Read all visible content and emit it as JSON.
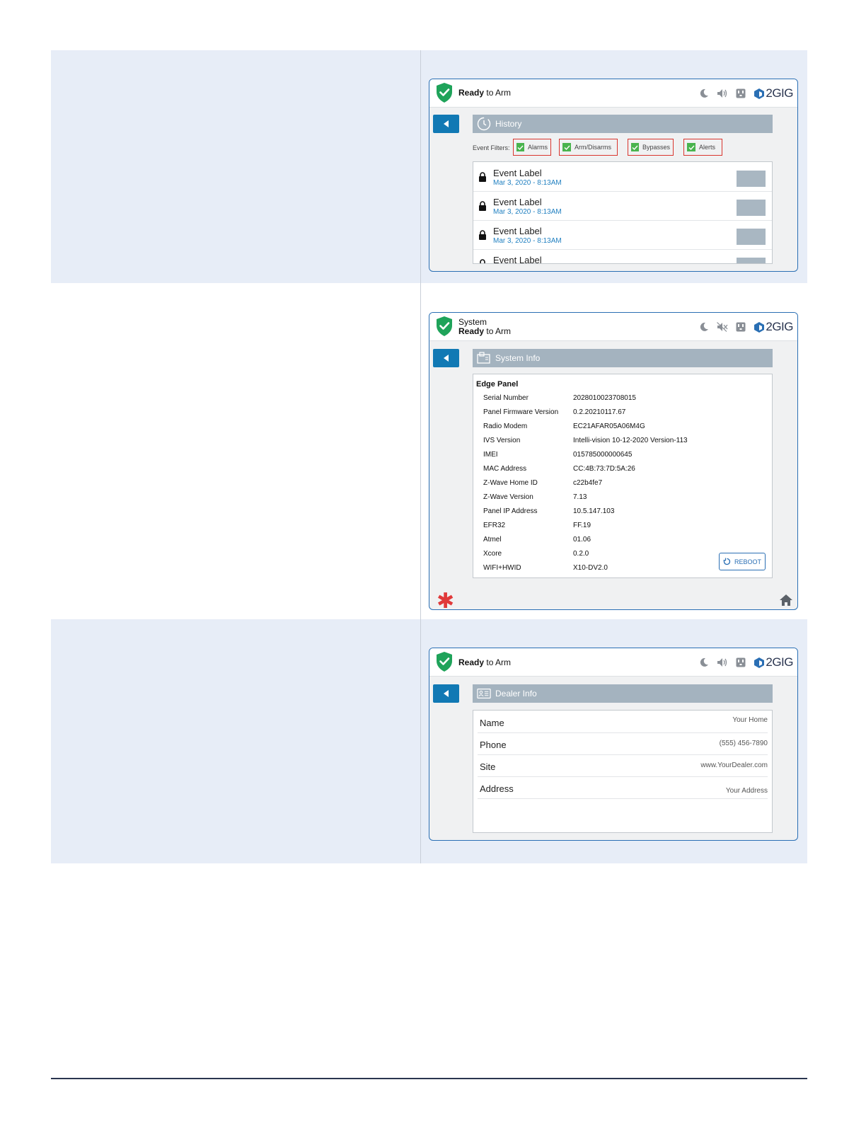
{
  "screens": {
    "history": {
      "status": {
        "bold": "Ready",
        "rest": " to Arm"
      },
      "brand": "2GIG",
      "title": "History",
      "filters_label": "Event Filters:",
      "filters": [
        "Alarms",
        "Arm/Disarms",
        "Bypasses",
        "Alerts"
      ],
      "events": [
        {
          "label": "Event Label",
          "date": "Mar 3, 2020 - 8:13AM"
        },
        {
          "label": "Event Label",
          "date": "Mar 3, 2020 - 8:13AM"
        },
        {
          "label": "Event Label",
          "date": "Mar 3, 2020 - 8:13AM"
        },
        {
          "label": "Event Label",
          "date": ""
        }
      ]
    },
    "system_info": {
      "status": {
        "line1": "System",
        "bold": "Ready",
        "rest": " to Arm"
      },
      "brand": "2GIG",
      "title": "System Info",
      "heading": "Edge Panel",
      "rows": [
        {
          "key": "Serial Number",
          "value": "2028010023708015"
        },
        {
          "key": "Panel Firmware Version",
          "value": "0.2.20210117.67"
        },
        {
          "key": "Radio Modem",
          "value": "EC21AFAR05A06M4G"
        },
        {
          "key": "IVS Version",
          "value": "Intelli-vision 10-12-2020 Version-113"
        },
        {
          "key": "IMEI",
          "value": "015785000000645"
        },
        {
          "key": "MAC Address",
          "value": "CC:4B:73:7D:5A:26"
        },
        {
          "key": "Z-Wave Home ID",
          "value": "c22b4fe7"
        },
        {
          "key": "Z-Wave Version",
          "value": "7.13"
        },
        {
          "key": "Panel IP Address",
          "value": "10.5.147.103"
        },
        {
          "key": "EFR32",
          "value": "FF.19"
        },
        {
          "key": "Atmel",
          "value": "01.06"
        },
        {
          "key": "Xcore",
          "value": "0.2.0"
        },
        {
          "key": "WIFI+HWID",
          "value": "X10-DV2.0"
        }
      ],
      "reboot_label": "REBOOT",
      "asterisk": "✱"
    },
    "dealer_info": {
      "status": {
        "bold": "Ready",
        "rest": " to Arm"
      },
      "brand": "2GIG",
      "title": "Dealer Info",
      "rows": [
        {
          "key": "Name",
          "value": "Your Home"
        },
        {
          "key": "Phone",
          "value": "(555) 456-7890"
        },
        {
          "key": "Site",
          "value": "www.YourDealer.com"
        },
        {
          "key": "Address",
          "value": "Your Address"
        }
      ]
    }
  },
  "colors": {
    "band": "#e7edf7",
    "accent_blue": "#1179b4",
    "title_bar": "#a4b3bf",
    "shield_green": "#1fa35a",
    "filter_border": "#d9352e",
    "check_green": "#49b44e",
    "date_blue": "#1f7fc0",
    "asterisk_red": "#e0393a"
  },
  "icons": [
    "shield-check-icon",
    "moon-icon",
    "speaker-icon",
    "speaker-muted-icon",
    "outlet-icon",
    "brand-logo-icon",
    "back-arrow-icon",
    "clock-history-icon",
    "system-info-icon",
    "dealer-card-icon",
    "lock-icon",
    "reboot-icon",
    "home-icon"
  ]
}
